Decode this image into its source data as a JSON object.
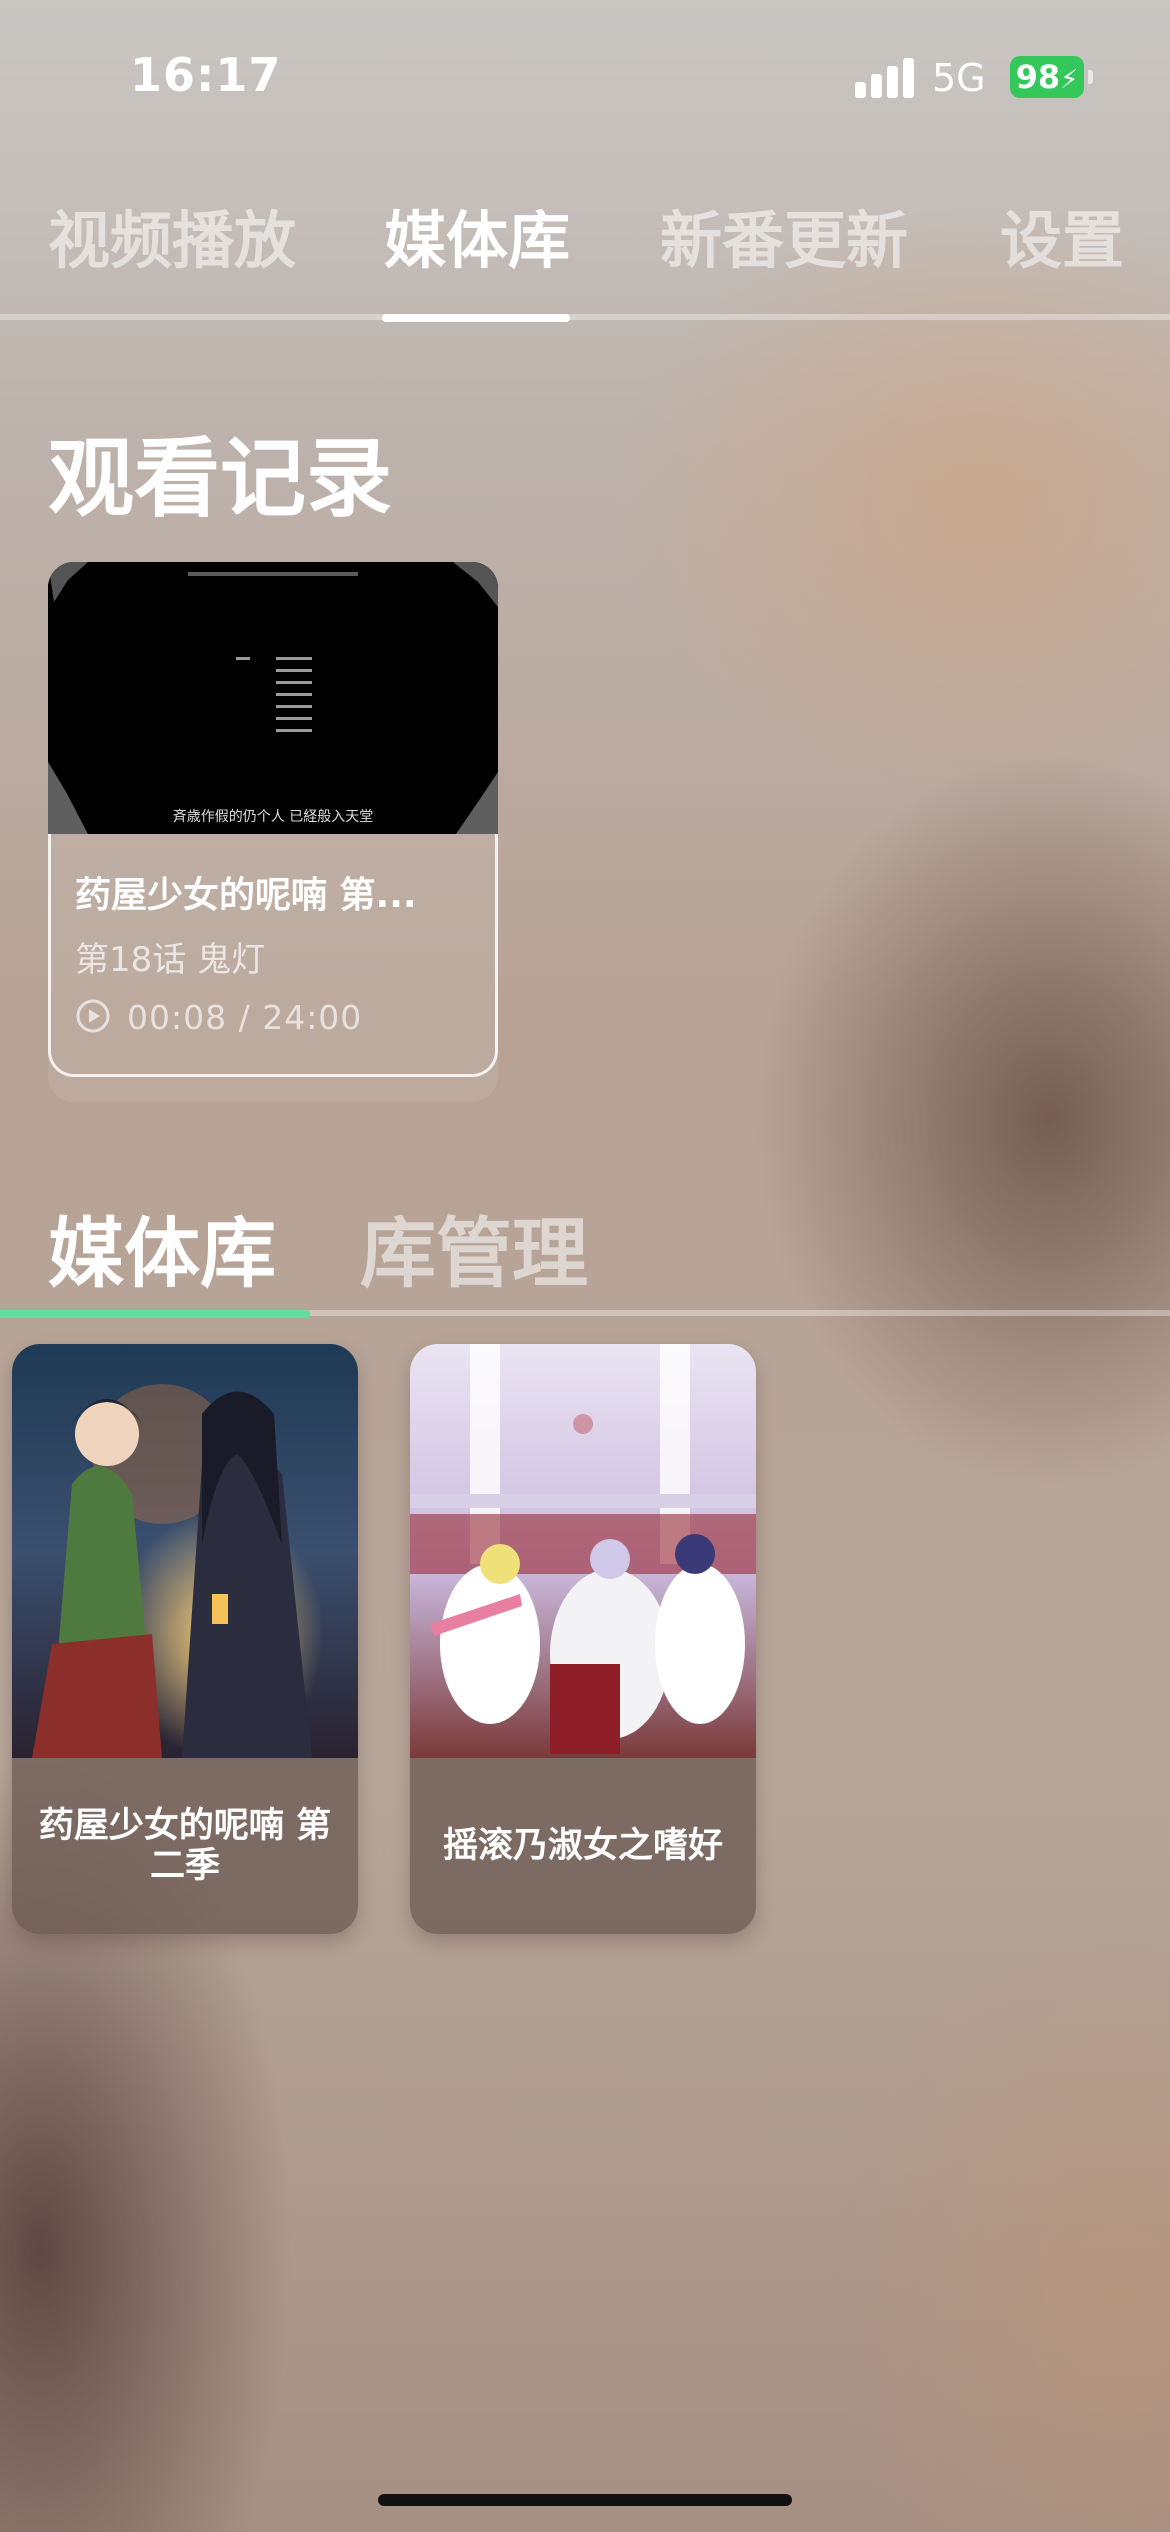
{
  "status_bar": {
    "time": "16:17",
    "network": "5G",
    "battery": "98"
  },
  "top_tabs": [
    {
      "label": "视频播放"
    },
    {
      "label": "媒体库"
    },
    {
      "label": "新番更新"
    },
    {
      "label": "设置"
    }
  ],
  "history": {
    "title": "观看记录",
    "items": [
      {
        "thumb_caption": "斉歳作假的仍个人 已経般入天堂",
        "title": "药屋少女的呢喃 第...",
        "episode": "第18话 鬼灯",
        "progress": "00:08 / 24:00"
      }
    ]
  },
  "library_tabs": [
    {
      "label": "媒体库"
    },
    {
      "label": "库管理"
    }
  ],
  "library": [
    {
      "title": "药屋少女的呢喃 第二季"
    },
    {
      "title": "摇滚乃淑女之嗜好"
    }
  ],
  "colors": {
    "accent_tab_indicator": "#5fe0a0",
    "battery": "#34c759"
  }
}
